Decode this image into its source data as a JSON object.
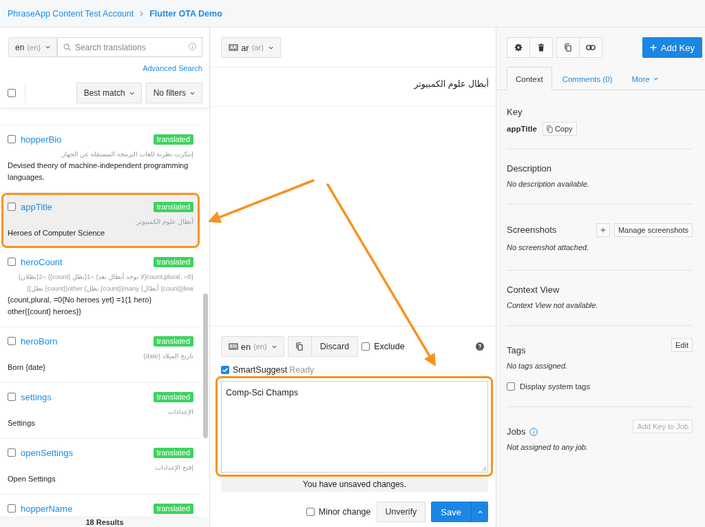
{
  "breadcrumb": [
    {
      "label": "PhraseApp Content Test Account",
      "current": false
    },
    {
      "label": "Flutter OTA Demo",
      "current": true
    }
  ],
  "key_list": {
    "locale_select": {
      "name": "en",
      "code": "(en)"
    },
    "search": {
      "placeholder": "Search translations"
    },
    "advanced_search": "Advanced Search",
    "select_all": {
      "checked": false
    },
    "sort": "Best match",
    "filter": "No filters",
    "items": [
      {
        "key": "hopperBio",
        "status": "translated",
        "translation": "إبتكرت نظرية للغات البرمجة المستقلة عن الجهاز.",
        "source": "Devised theory of machine-independent programming languages.",
        "checked": false,
        "selected": false,
        "highlighted": false
      },
      {
        "key": "appTitle",
        "status": "translated",
        "translation": "أبطال علوم الكمبيوتر",
        "source": "Heroes of Computer Science",
        "checked": false,
        "selected": true,
        "highlighted": true
      },
      {
        "key": "heroCount",
        "status": "translated",
        "translation": "{count,plural, =0{لا توجد أبطال بعد} =1{بطل {count}} =2{بطلان} few{{count} أبطال} many{{count} بطل} other{{count} بطل}}",
        "source": "{count,plural, =0{No heroes yet} =1{1 hero} other{{count} heroes}}",
        "checked": false,
        "selected": false,
        "highlighted": false
      },
      {
        "key": "heroBorn",
        "status": "translated",
        "translation": "تاريخ الميلاد {date}",
        "source": "Born {date}",
        "checked": false,
        "selected": false,
        "highlighted": false
      },
      {
        "key": "settings",
        "status": "translated",
        "translation": "الإعدادات",
        "source": "Settings",
        "checked": false,
        "selected": false,
        "highlighted": false
      },
      {
        "key": "openSettings",
        "status": "translated",
        "translation": "إفتح الإعدادات",
        "source": "Open Settings",
        "checked": false,
        "selected": false,
        "highlighted": false
      },
      {
        "key": "hopperName",
        "status": "translated",
        "checked": false,
        "selected": false,
        "highlighted": false
      }
    ],
    "results": "18 Results"
  },
  "editor": {
    "reference": {
      "badge": "AR",
      "name": "ar",
      "code": "(ar)",
      "text": "أبطال علوم الكمبيوتر"
    },
    "editor_locale": {
      "badge": "EN",
      "name": "en",
      "code": "(en)"
    },
    "discard": "Discard",
    "exclude": {
      "label": "Exclude",
      "checked": false
    },
    "smart_suggest": {
      "label": "SmartSuggest",
      "status": "Ready",
      "checked": true
    },
    "value": "Comp-Sci Champs",
    "highlighted": true,
    "notice": "You have unsaved changes.",
    "minor_change": {
      "label": "Minor change",
      "checked": false
    },
    "unverify": "Unverify",
    "save": "Save"
  },
  "details": {
    "add_key": "Add Key",
    "tabs": [
      {
        "label": "Context",
        "kind": "tab",
        "selected": true
      },
      {
        "label": "Comments (0)",
        "kind": "tab",
        "selected": false
      },
      {
        "label": "More",
        "kind": "menu",
        "selected": false
      }
    ],
    "sections": [
      {
        "kind": "key",
        "title": "Key",
        "value": "appTitle",
        "action": {
          "label": "Copy",
          "disabled": false
        }
      },
      {
        "kind": "text",
        "title": "Description",
        "note": "No description available."
      },
      {
        "kind": "screenshots",
        "title": "Screenshots",
        "action": {
          "label": "Manage screenshots",
          "disabled": false
        },
        "note": "No screenshot attached."
      },
      {
        "kind": "text",
        "title": "Context View",
        "note": "Context View not available."
      },
      {
        "kind": "tags",
        "title": "Tags",
        "action": {
          "label": "Edit",
          "disabled": false
        },
        "note": "No tags assigned.",
        "option": {
          "label": "Display system tags",
          "checked": false
        }
      },
      {
        "kind": "jobs",
        "title": "Jobs",
        "action": {
          "label": "Add Key to Job",
          "disabled": true
        },
        "note": "Not assigned to any job."
      }
    ]
  }
}
